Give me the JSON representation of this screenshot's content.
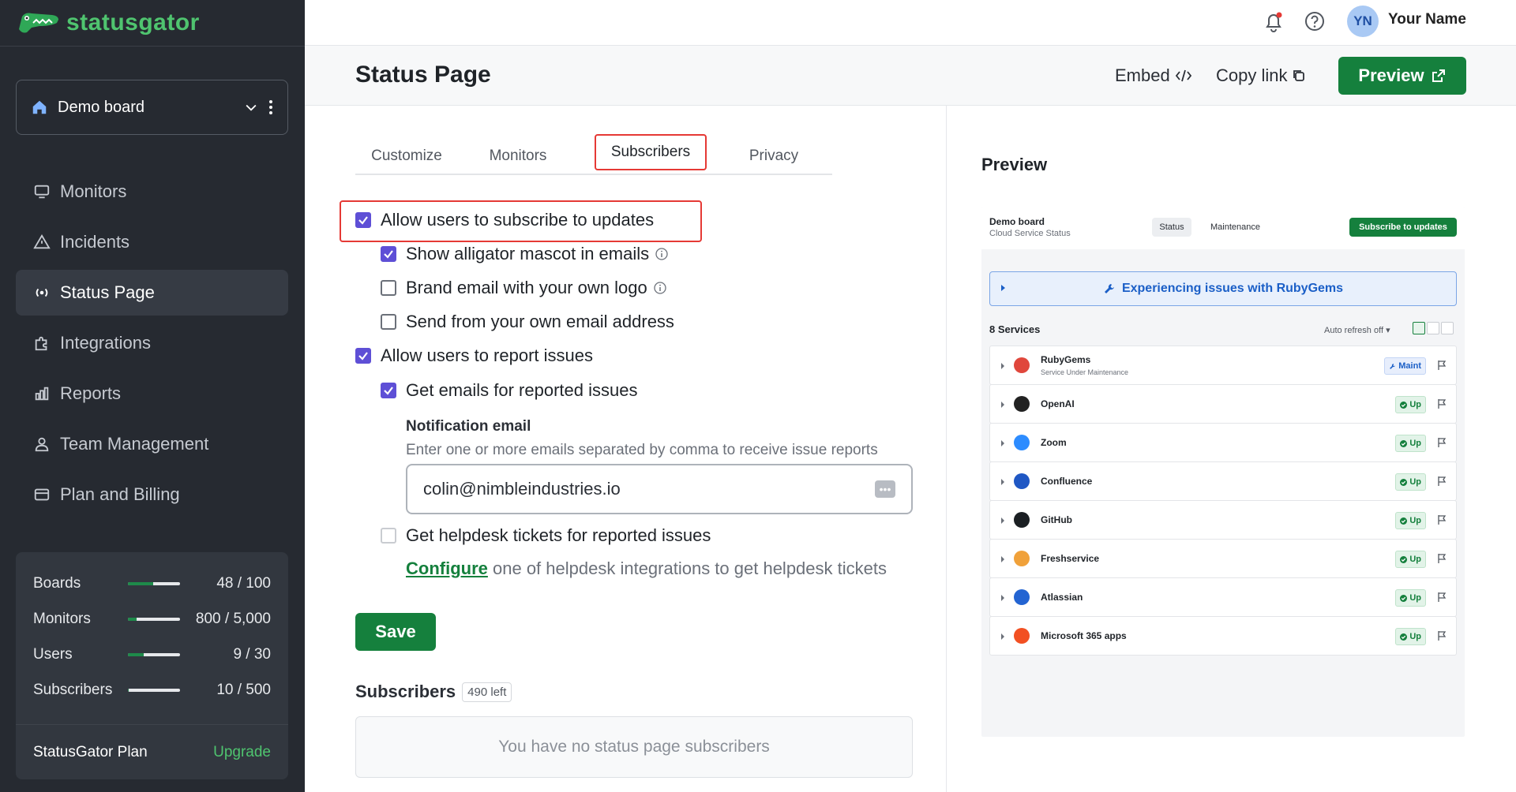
{
  "brand": {
    "name": "statusgator",
    "color": "#4fc46f"
  },
  "topbar": {
    "avatar_initials": "YN",
    "user_name": "Your Name"
  },
  "sidebar": {
    "board": "Demo board",
    "items": [
      {
        "label": "Monitors",
        "icon": "monitor-icon",
        "active": false
      },
      {
        "label": "Incidents",
        "icon": "warning-triangle-icon",
        "active": false
      },
      {
        "label": "Status Page",
        "icon": "broadcast-icon",
        "active": true
      },
      {
        "label": "Integrations",
        "icon": "puzzle-icon",
        "active": false
      },
      {
        "label": "Reports",
        "icon": "bar-chart-icon",
        "active": false
      },
      {
        "label": "Team Management",
        "icon": "user-icon",
        "active": false
      },
      {
        "label": "Plan and Billing",
        "icon": "credit-card-icon",
        "active": false
      }
    ],
    "usage": [
      {
        "name": "Boards",
        "value": "48 / 100",
        "fraction": 0.48
      },
      {
        "name": "Monitors",
        "value": "800 / 5,000",
        "fraction": 0.16
      },
      {
        "name": "Users",
        "value": "9 / 30",
        "fraction": 0.3
      },
      {
        "name": "Subscribers",
        "value": "10 / 500",
        "fraction": 0.02
      }
    ],
    "plan": {
      "name": "StatusGator Plan",
      "upgrade": "Upgrade"
    }
  },
  "header": {
    "title": "Status Page",
    "embed": "Embed",
    "copy_link": "Copy link",
    "preview": "Preview"
  },
  "tabs": [
    "Customize",
    "Monitors",
    "Subscribers",
    "Privacy"
  ],
  "active_tab": "Subscribers",
  "options": {
    "allow_subscribe": {
      "label": "Allow users to subscribe to updates",
      "checked": true
    },
    "show_mascot": {
      "label": "Show alligator mascot in emails",
      "checked": true
    },
    "brand_logo": {
      "label": "Brand email with your own logo",
      "checked": false
    },
    "own_email": {
      "label": "Send from your own email address",
      "checked": false
    },
    "allow_report": {
      "label": "Allow users to report issues",
      "checked": true
    },
    "emails_reported": {
      "label": "Get emails for reported issues",
      "checked": true
    },
    "helpdesk": {
      "label": "Get helpdesk tickets for reported issues",
      "checked": false
    }
  },
  "notification": {
    "title": "Notification email",
    "hint": "Enter one or more emails separated by comma to receive issue reports",
    "value": "colin@nimbleindustries.io"
  },
  "configure": {
    "link": "Configure",
    "rest": " one of helpdesk integrations to get helpdesk tickets"
  },
  "save": "Save",
  "subscribers": {
    "heading": "Subscribers",
    "left": "490 left",
    "empty": "You have no status page subscribers"
  },
  "preview_panel": {
    "heading": "Preview",
    "board": "Demo board",
    "subtitle": "Cloud Service Status",
    "tab_status": "Status",
    "tab_maintenance": "Maintenance",
    "subscribe": "Subscribe to updates",
    "banner": "Experiencing issues with RubyGems",
    "count": "8 Services",
    "auto_refresh": "Auto refresh off",
    "services": [
      {
        "name": "RubyGems",
        "sub": "Service Under Maintenance",
        "status": "Maint",
        "kind": "maint",
        "color": "#e0473c"
      },
      {
        "name": "OpenAI",
        "sub": "",
        "status": "Up",
        "kind": "up",
        "color": "#222222"
      },
      {
        "name": "Zoom",
        "sub": "",
        "status": "Up",
        "kind": "up",
        "color": "#2d8cff"
      },
      {
        "name": "Confluence",
        "sub": "",
        "status": "Up",
        "kind": "up",
        "color": "#1f57c4"
      },
      {
        "name": "GitHub",
        "sub": "",
        "status": "Up",
        "kind": "up",
        "color": "#1b1f23"
      },
      {
        "name": "Freshservice",
        "sub": "",
        "status": "Up",
        "kind": "up",
        "color": "#f0a13a"
      },
      {
        "name": "Atlassian",
        "sub": "",
        "status": "Up",
        "kind": "up",
        "color": "#2364d2"
      },
      {
        "name": "Microsoft 365 apps",
        "sub": "",
        "status": "Up",
        "kind": "up",
        "color": "#f25022"
      }
    ]
  }
}
